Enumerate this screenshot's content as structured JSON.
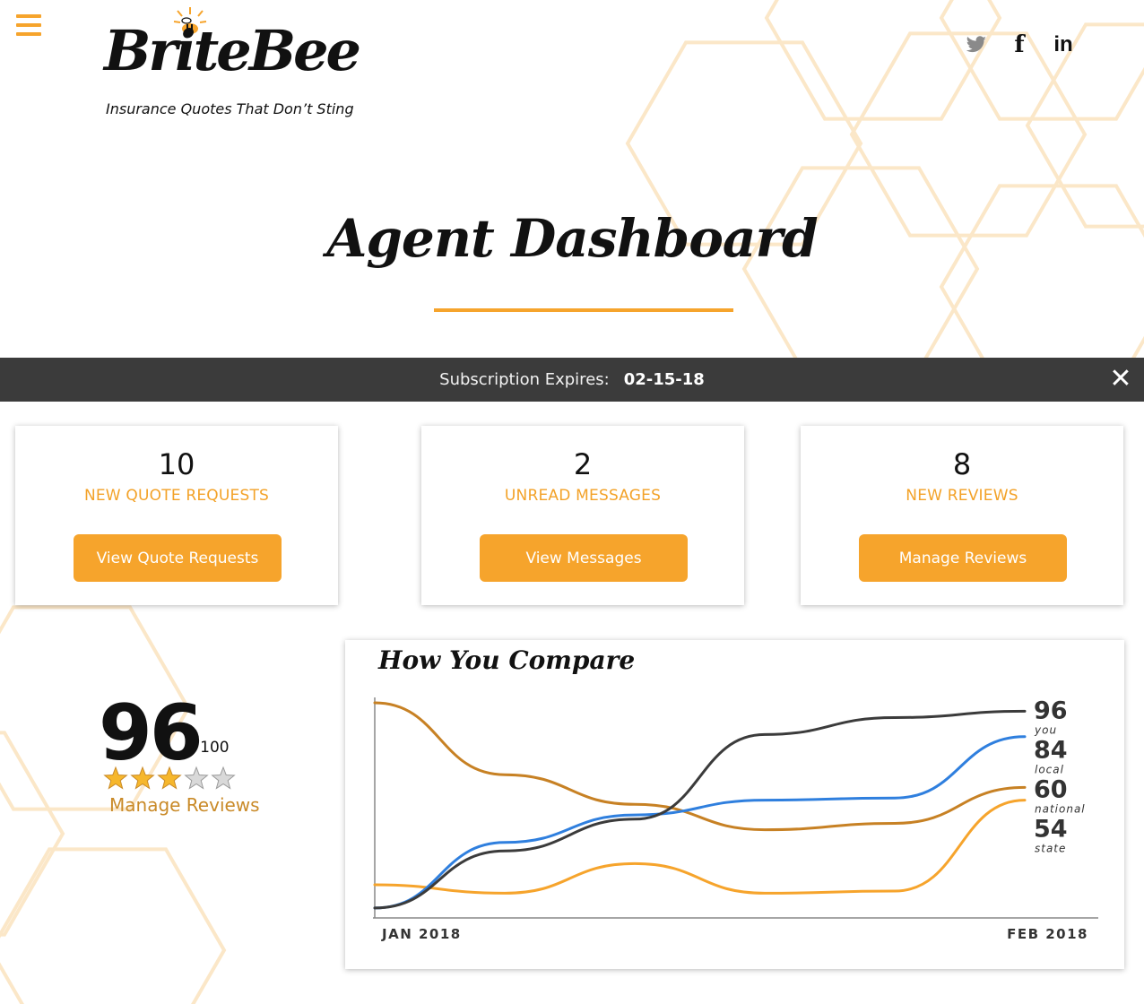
{
  "brand": {
    "name": "BriteBee",
    "tagline": "Insurance Quotes That Don’t Sting",
    "accent_color": "#f6a42c"
  },
  "header": {
    "menu_icon": "hamburger-menu-icon",
    "social": [
      {
        "icon": "twitter-icon"
      },
      {
        "icon": "facebook-icon",
        "glyph": "f"
      },
      {
        "icon": "linkedin-icon",
        "glyph": "in"
      }
    ]
  },
  "page": {
    "title": "Agent Dashboard"
  },
  "subscription": {
    "label": "Subscription Expires:",
    "date": "02-15-18",
    "close_glyph": "✕"
  },
  "cards": [
    {
      "count": "10",
      "label": "NEW QUOTE REQUESTS",
      "button": "View Quote Requests"
    },
    {
      "count": "2",
      "label": "UNREAD MESSAGES",
      "button": "View Messages"
    },
    {
      "count": "8",
      "label": "NEW REVIEWS",
      "button": "Manage Reviews"
    }
  ],
  "rating": {
    "score": "96",
    "max": "/ 100",
    "stars_filled": 3,
    "stars_total": 5,
    "link": "Manage Reviews"
  },
  "chart_data": {
    "type": "line",
    "title": "How You Compare",
    "x_labels": [
      "JAN 2018",
      "FEB 2018"
    ],
    "x": [
      0,
      1,
      2,
      3,
      4,
      5
    ],
    "ylim": [
      0,
      100
    ],
    "grid": false,
    "series": [
      {
        "name": "you",
        "color": "#3b3b3b",
        "values": [
          3,
          30,
          45,
          85,
          93,
          96
        ],
        "end_label": "96"
      },
      {
        "name": "local",
        "color": "#2f7fde",
        "values": [
          3,
          34,
          47,
          54,
          55,
          84
        ],
        "end_label": "84"
      },
      {
        "name": "national",
        "color": "#c78124",
        "values": [
          100,
          66,
          52,
          40,
          43,
          60
        ],
        "end_label": "60"
      },
      {
        "name": "state",
        "color": "#f6a42c",
        "values": [
          14,
          10,
          24,
          10,
          11,
          54
        ],
        "end_label": "54"
      }
    ]
  }
}
